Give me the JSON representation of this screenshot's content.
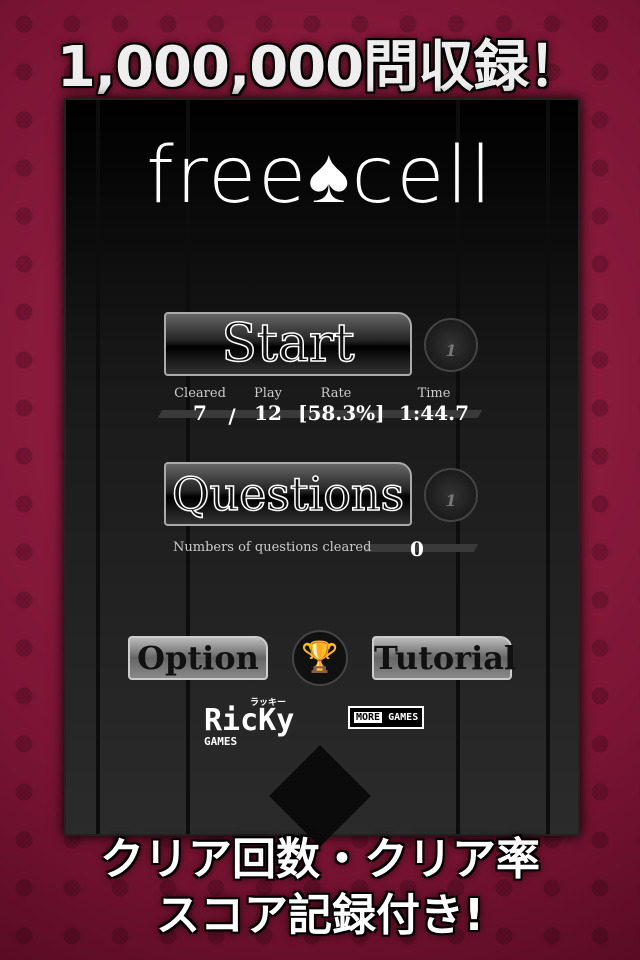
{
  "promo": {
    "top": "1,000,000問収録！",
    "bottom_line1": "クリア回数・クリア率",
    "bottom_line2": "スコア記録付き!"
  },
  "logo": "free♠cell",
  "start": {
    "label": "Start",
    "rank_badge": "1"
  },
  "stats": {
    "cleared_label": "Cleared",
    "cleared": "7",
    "sep": "/",
    "play_label": "Play",
    "play": "12",
    "rate_label": "Rate",
    "rate": "[58.3%]",
    "time_label": "Time",
    "time": "1:44.7"
  },
  "questions": {
    "label": "Questions",
    "rank_badge": "1",
    "cleared_label": "Numbers of questions cleared",
    "cleared": "0"
  },
  "option_label": "Option",
  "tutorial_label": "Tutorial",
  "ricky": {
    "name": "RicKy",
    "sub": "GAMES",
    "kana": "ラッキー"
  },
  "more_games": {
    "more": "MORE",
    "games": "GAMES"
  },
  "colors": {
    "background": "#8a1c3c",
    "panel": "#1a1a1a"
  }
}
